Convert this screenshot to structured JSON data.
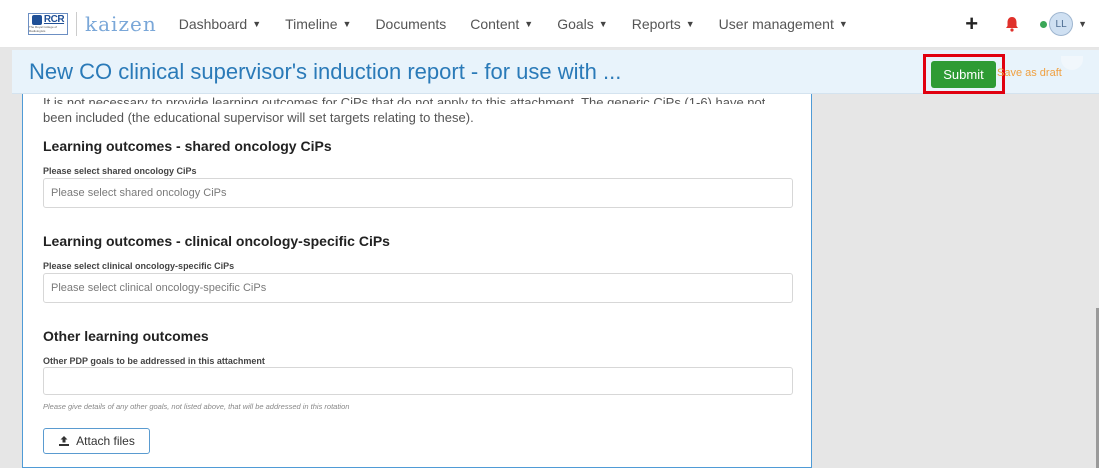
{
  "nav": {
    "logo_abbr": "RCR",
    "logo_tiny": "The Royal College of Radiologists",
    "brand": "kaizen",
    "items": [
      {
        "label": "Dashboard",
        "dropdown": true
      },
      {
        "label": "Timeline",
        "dropdown": true
      },
      {
        "label": "Documents",
        "dropdown": false
      },
      {
        "label": "Content",
        "dropdown": true
      },
      {
        "label": "Goals",
        "dropdown": true
      },
      {
        "label": "Reports",
        "dropdown": true
      },
      {
        "label": "User management",
        "dropdown": true
      }
    ],
    "plus_symbol": "+",
    "avatar_initials": "LL",
    "icons": [
      "plus-icon",
      "bell-icon",
      "status-dot",
      "avatar"
    ],
    "colors": {
      "bell": "#e0312b",
      "status": "#3aa757"
    }
  },
  "title_bar": {
    "title": "New CO clinical supervisor's induction report - for use with ...",
    "submit_label": "Submit",
    "draft_label": "Save as draft",
    "colors": {
      "title": "#2a7ab8",
      "submit_bg": "#2e9b34",
      "highlight": "#e0000f",
      "draft": "#f0a040"
    }
  },
  "form": {
    "intro_cut": "It is not necessary to provide learning outcomes for CiPs that do not apply to this attachment. The generic CiPs (1-6) have not",
    "intro": "been included (the educational supervisor will set targets relating to these).",
    "sections": [
      {
        "title": "Learning outcomes - shared oncology CiPs",
        "field_label": "Please select shared oncology CiPs",
        "placeholder": "Please select shared oncology CiPs"
      },
      {
        "title": "Learning outcomes - clinical oncology-specific CiPs",
        "field_label": "Please select clinical oncology-specific CiPs",
        "placeholder": "Please select clinical oncology-specific CiPs"
      },
      {
        "title": "Other learning outcomes",
        "field_label": "Other PDP goals to be addressed in this attachment",
        "value": "",
        "help": "Please give details of any other goals, not listed above, that will be addressed in this rotation"
      }
    ],
    "attach_label": "Attach files"
  }
}
